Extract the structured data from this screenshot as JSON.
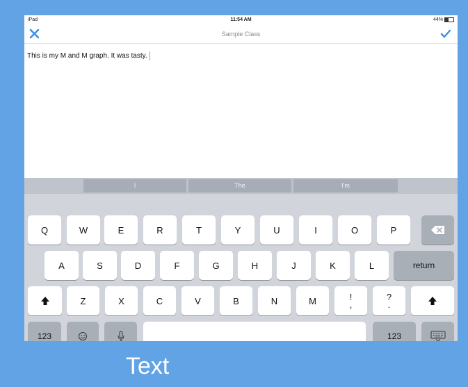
{
  "status_bar": {
    "left": "iPad",
    "time": "11:54 AM",
    "battery": "44%"
  },
  "nav": {
    "title": "Sample Class",
    "close_icon": "x-icon",
    "done_icon": "checkmark-icon"
  },
  "editor": {
    "text": "This is my M and M graph. It was tasty."
  },
  "suggestions": [
    "I",
    "The",
    "I'm"
  ],
  "keys": {
    "row1": [
      "Q",
      "W",
      "E",
      "R",
      "T",
      "Y",
      "U",
      "I",
      "O",
      "P"
    ],
    "row2": [
      "A",
      "S",
      "D",
      "F",
      "G",
      "H",
      "J",
      "K",
      "L"
    ],
    "row3": [
      "Z",
      "X",
      "C",
      "V",
      "B",
      "N",
      "M"
    ],
    "row3_punct": [
      [
        "!",
        ","
      ],
      [
        "?",
        "."
      ]
    ],
    "return": "return",
    "num": "123",
    "emoji_icon": "emoji-icon",
    "mic_icon": "microphone-icon",
    "dismiss_icon": "keyboard-dismiss-icon",
    "shift_icon": "shift-arrow-icon",
    "backspace_icon": "backspace-icon"
  },
  "colors": {
    "accent": "#3a8ee6",
    "background": "#62a3e6"
  },
  "caption": "Text"
}
